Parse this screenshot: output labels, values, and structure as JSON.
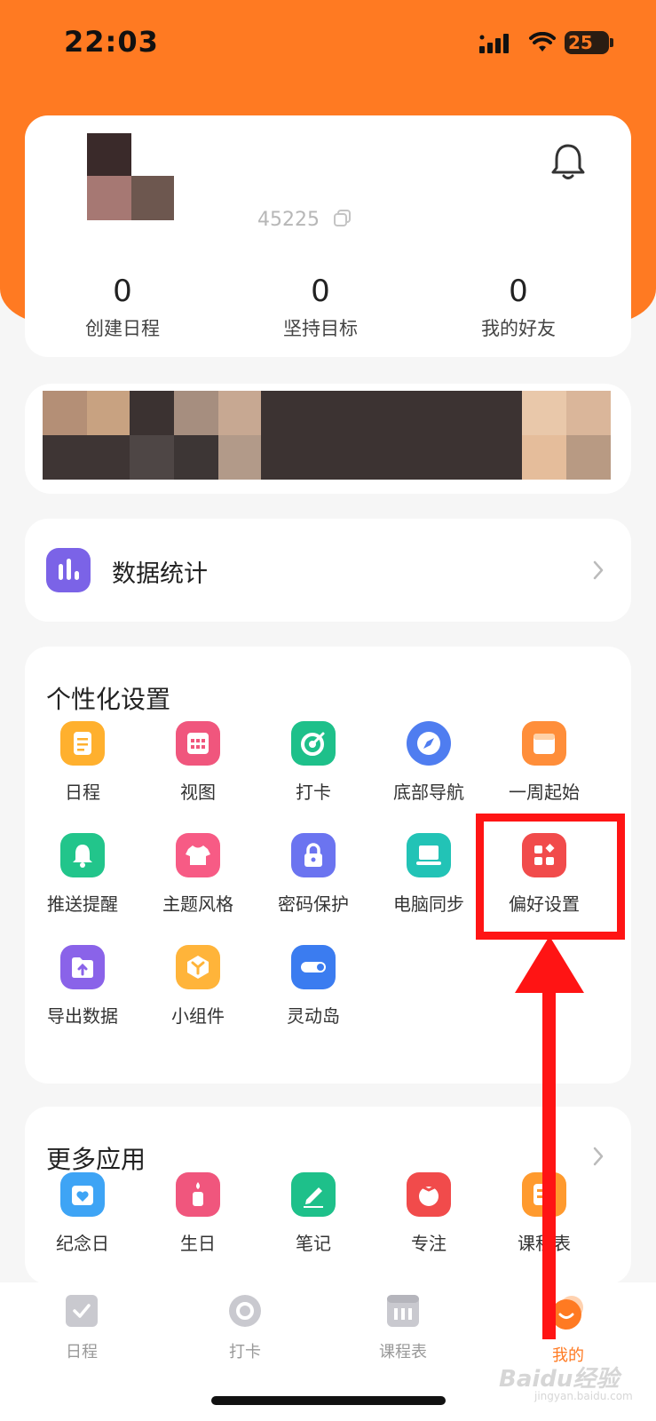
{
  "status_bar": {
    "time": "22:03",
    "battery": "25"
  },
  "profile": {
    "uid_partial": "45225",
    "stats": [
      {
        "value": "0",
        "label": "创建日程"
      },
      {
        "value": "0",
        "label": "坚持目标"
      },
      {
        "value": "0",
        "label": "我的好友"
      }
    ]
  },
  "data_stats": {
    "label": "数据统计"
  },
  "personal_settings": {
    "title": "个性化设置",
    "items": [
      {
        "label": "日程",
        "icon": "schedule-icon",
        "color": "#ffb02e"
      },
      {
        "label": "视图",
        "icon": "calendar-grid-icon",
        "color": "#f0567d"
      },
      {
        "label": "打卡",
        "icon": "checkin-target-icon",
        "color": "#1ec08a"
      },
      {
        "label": "底部导航",
        "icon": "compass-icon",
        "color": "#4f7df0"
      },
      {
        "label": "一周起始",
        "icon": "week-calendar-icon",
        "color": "#ff8e3a"
      },
      {
        "label": "推送提醒",
        "icon": "bell-icon",
        "color": "#22c58b"
      },
      {
        "label": "主题风格",
        "icon": "tshirt-icon",
        "color": "#f75b85"
      },
      {
        "label": "密码保护",
        "icon": "lock-icon",
        "color": "#6b74f0"
      },
      {
        "label": "电脑同步",
        "icon": "laptop-icon",
        "color": "#22c3b6"
      },
      {
        "label": "偏好设置",
        "icon": "preferences-icon",
        "color": "#f14b4b"
      },
      {
        "label": "导出数据",
        "icon": "export-folder-icon",
        "color": "#8a63e9"
      },
      {
        "label": "小组件",
        "icon": "widget-box-icon",
        "color": "#ffb43a"
      },
      {
        "label": "灵动岛",
        "icon": "toggle-island-icon",
        "color": "#3b7cf0"
      }
    ]
  },
  "more_apps": {
    "title": "更多应用",
    "items": [
      {
        "label": "纪念日",
        "icon": "anniversary-icon",
        "color": "#3ea4f5"
      },
      {
        "label": "生日",
        "icon": "birthday-candle-icon",
        "color": "#f0567d"
      },
      {
        "label": "笔记",
        "icon": "pencil-note-icon",
        "color": "#1ec08a"
      },
      {
        "label": "专注",
        "icon": "tomato-focus-icon",
        "color": "#f14b4b"
      },
      {
        "label": "课程表",
        "icon": "timetable-icon",
        "color": "#ff9a2e"
      }
    ]
  },
  "tabbar": {
    "tabs": [
      {
        "label": "日程",
        "icon": "checkbox-icon",
        "active": false
      },
      {
        "label": "打卡",
        "icon": "ring-icon",
        "active": false
      },
      {
        "label": "课程表",
        "icon": "timetable-icon",
        "active": false
      },
      {
        "label": "我的",
        "icon": "profile-smile-icon",
        "active": true
      }
    ]
  },
  "watermark": {
    "brand": "Baidu经验",
    "domain": "jingyan.baidu.com"
  },
  "colors": {
    "brand_orange": "#ff7a22",
    "annotation_red": "#ff1414"
  }
}
